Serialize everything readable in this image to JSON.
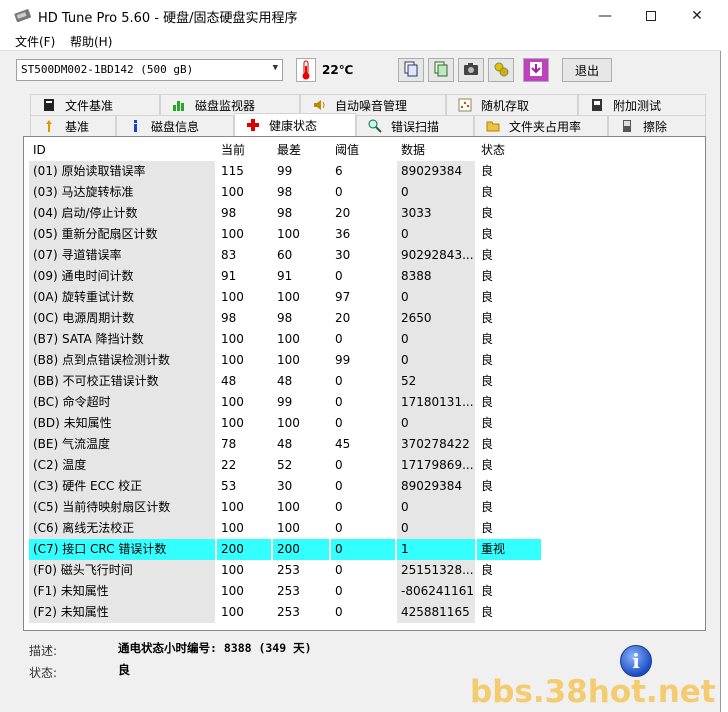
{
  "window": {
    "title": "HD Tune Pro 5.60 - 硬盘/固态硬盘实用程序"
  },
  "menu": {
    "file": "文件(F)",
    "help": "帮助(H)"
  },
  "toolbar": {
    "drive": "ST500DM002-1BD142 (500 gB)",
    "temperature": "22℃",
    "exit": "退出"
  },
  "tabs_top": [
    "文件基准",
    "磁盘监视器",
    "自动噪音管理",
    "随机存取",
    "附加测试"
  ],
  "tabs_bottom": [
    "基准",
    "磁盘信息",
    "健康状态",
    "错误扫描",
    "文件夹占用率",
    "擦除"
  ],
  "table": {
    "headers": [
      "ID",
      "当前",
      "最差",
      "阈值",
      "数据",
      "状态"
    ],
    "rows": [
      [
        "(01) 原始读取错误率",
        "115",
        "99",
        "6",
        "89029384",
        "良"
      ],
      [
        "(03) 马达旋转标准",
        "100",
        "98",
        "0",
        "0",
        "良"
      ],
      [
        "(04) 启动/停止计数",
        "98",
        "98",
        "20",
        "3033",
        "良"
      ],
      [
        "(05) 重新分配扇区计数",
        "100",
        "100",
        "36",
        "0",
        "良"
      ],
      [
        "(07) 寻道错误率",
        "83",
        "60",
        "30",
        "90292843...",
        "良"
      ],
      [
        "(09) 通电时间计数",
        "91",
        "91",
        "0",
        "8388",
        "良"
      ],
      [
        "(0A) 旋转重试计数",
        "100",
        "100",
        "97",
        "0",
        "良"
      ],
      [
        "(0C) 电源周期计数",
        "98",
        "98",
        "20",
        "2650",
        "良"
      ],
      [
        "(B7) SATA 降挡计数",
        "100",
        "100",
        "0",
        "0",
        "良"
      ],
      [
        "(B8) 点到点错误检测计数",
        "100",
        "100",
        "99",
        "0",
        "良"
      ],
      [
        "(BB) 不可校正错误计数",
        "48",
        "48",
        "0",
        "52",
        "良"
      ],
      [
        "(BC) 命令超时",
        "100",
        "99",
        "0",
        "17180131...",
        "良"
      ],
      [
        "(BD) 未知属性",
        "100",
        "100",
        "0",
        "0",
        "良"
      ],
      [
        "(BE) 气流温度",
        "78",
        "48",
        "45",
        "370278422",
        "良"
      ],
      [
        "(C2) 温度",
        "22",
        "52",
        "0",
        "17179869...",
        "良"
      ],
      [
        "(C3) 硬件 ECC 校正",
        "53",
        "30",
        "0",
        "89029384",
        "良"
      ],
      [
        "(C5) 当前待映射扇区计数",
        "100",
        "100",
        "0",
        "0",
        "良"
      ],
      [
        "(C6) 离线无法校正",
        "100",
        "100",
        "0",
        "0",
        "良"
      ],
      [
        "(C7) 接口 CRC 错误计数",
        "200",
        "200",
        "0",
        "1",
        "重视"
      ],
      [
        "(F0) 磁头飞行时间",
        "100",
        "253",
        "0",
        "25151328...",
        "良"
      ],
      [
        "(F1) 未知属性",
        "100",
        "253",
        "0",
        "-806241161",
        "良"
      ],
      [
        "(F2) 未知属性",
        "100",
        "253",
        "0",
        "425881165",
        "良"
      ]
    ]
  },
  "footer": {
    "desc_label": "描述:",
    "desc_value": "通电状态小时编号: 8388 (349 天)",
    "status_label": "状态:",
    "status_value": "良"
  },
  "watermark": "bbs.38hot.net",
  "colors": {
    "selected_row": "#33ffff",
    "id_column": "#e6e6e6"
  }
}
